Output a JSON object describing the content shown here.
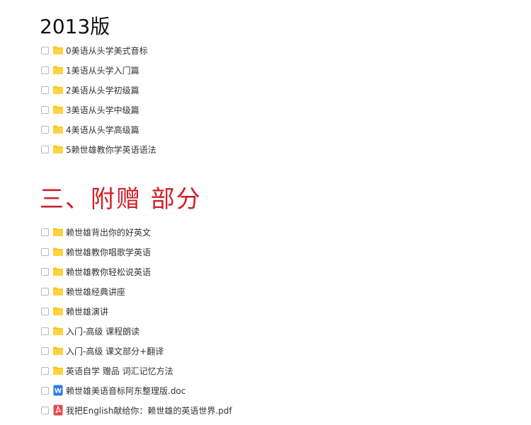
{
  "section_2013": {
    "title": "2013版",
    "items": [
      {
        "type": "folder",
        "name": "0美语从头学美式音标"
      },
      {
        "type": "folder",
        "name": "1美语从头学入门篇"
      },
      {
        "type": "folder",
        "name": "2美语从头学初级篇"
      },
      {
        "type": "folder",
        "name": "3美语从头学中级篇"
      },
      {
        "type": "folder",
        "name": "4美语从头学高级篇"
      },
      {
        "type": "folder",
        "name": "5赖世雄教你学英语语法"
      }
    ]
  },
  "section_bonus": {
    "title": "三、附赠  部分",
    "items": [
      {
        "type": "folder",
        "name": "赖世雄背出你的好英文"
      },
      {
        "type": "folder",
        "name": "赖世雄教你唱歌学英语"
      },
      {
        "type": "folder",
        "name": "赖世雄教你轻松说英语"
      },
      {
        "type": "folder",
        "name": "赖世雄经典讲座"
      },
      {
        "type": "folder",
        "name": "赖世雄演讲"
      },
      {
        "type": "folder",
        "name": "入门-高级 课程朗读"
      },
      {
        "type": "folder",
        "name": "入门-高级 课文部分+翻译"
      },
      {
        "type": "folder",
        "name": "英语自学 赠品 词汇记忆方法"
      },
      {
        "type": "word-doc",
        "name": "赖世雄美语音标阿东整理版.doc"
      },
      {
        "type": "pdf",
        "name": "我把English献给你：赖世雄的英语世界.pdf"
      }
    ]
  },
  "colors": {
    "folder": "#f7c51e",
    "word": "#2f7de1",
    "pdf": "#e34b4b",
    "bonus_heading": "#d0202a"
  }
}
